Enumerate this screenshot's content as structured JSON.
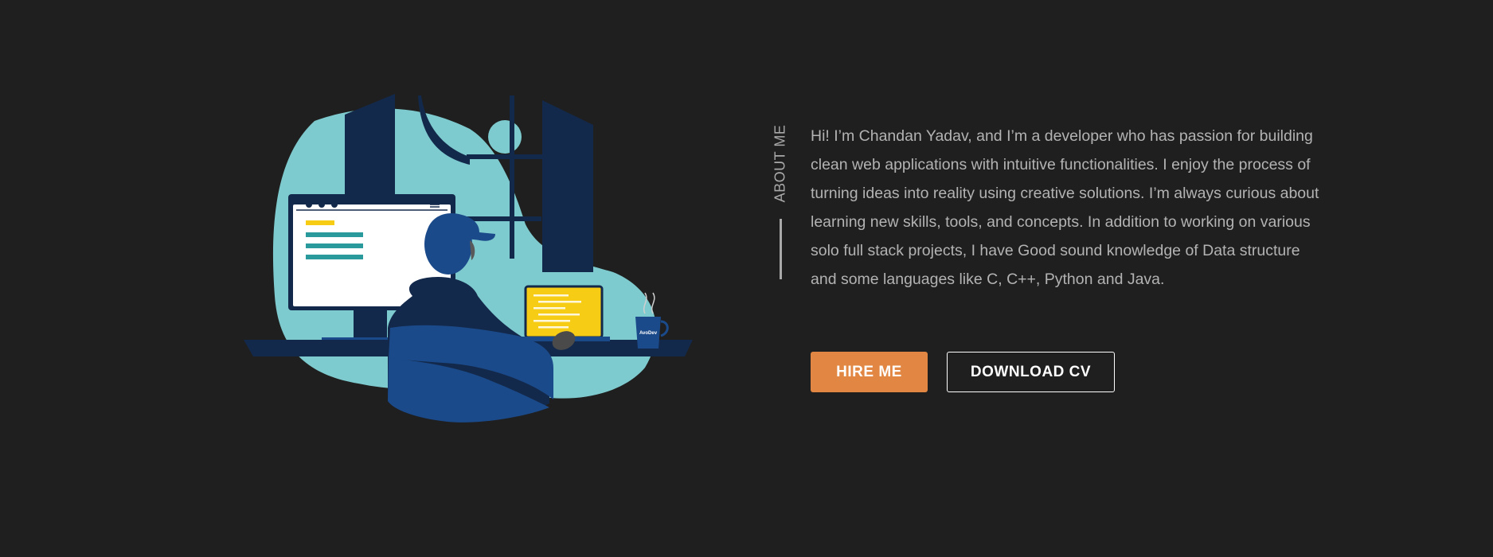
{
  "about": {
    "section_label": "ABOUT ME",
    "bio": "Hi! I’m Chandan Yadav, and I’m a developer who has passion for building clean web applications with intuitive functionalities. I enjoy the process of turning ideas into reality using creative solutions. I’m always curious about learning new skills, tools, and concepts. In addition to working on various solo full stack projects, I have Good sound knowledge of Data structure and some languages like C, C++, Python and Java.",
    "hire_button": "HIRE ME",
    "cv_button": "DOWNLOAD CV",
    "mug_logo": "AvoDev"
  },
  "colors": {
    "background": "#1f1f1f",
    "accent": "#e28743",
    "text": "#b3b3b3",
    "teal_blob": "#7ecbcf",
    "navy": "#13294b",
    "blue": "#1b4a8a",
    "yellow": "#f7cc14"
  }
}
